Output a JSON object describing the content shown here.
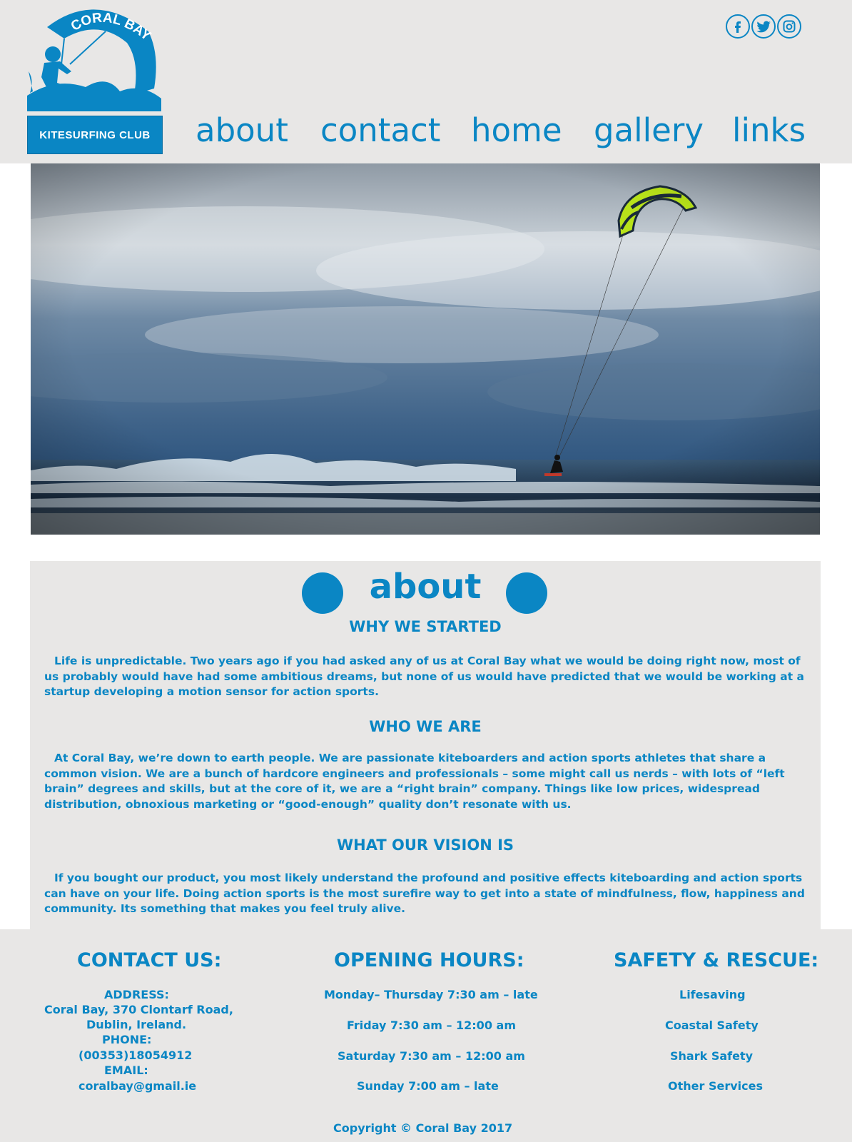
{
  "header": {
    "logo": {
      "arc_text": "CORAL BAY",
      "box_text": "KITESURFING CLUB"
    },
    "social": [
      {
        "name": "facebook-icon",
        "glyph": "f"
      },
      {
        "name": "twitter-icon",
        "glyph": "t"
      },
      {
        "name": "instagram-icon",
        "glyph": "ig"
      }
    ],
    "nav": [
      "about",
      "contact",
      "home",
      "gallery",
      "links"
    ]
  },
  "about": {
    "title": "about",
    "sections": [
      {
        "heading": "WHY WE STARTED",
        "body": "Life is unpredictable. Two years ago if you had asked any of us at Coral Bay what we would be doing right now, most of us probably would have had some ambitious dreams, but none of us would have predicted that we would be working at a startup developing a motion sensor for action sports."
      },
      {
        "heading": "WHO WE ARE",
        "body": "At Coral Bay, we’re down to earth people. We are passionate kiteboarders and action sports athletes that share a common vision. We are a bunch of hardcore engineers and professionals – some might call us nerds – with lots of “left brain” degrees and skills, but at the core of it, we are a “right brain” company. Things like low prices, widespread distribution, obnoxious marketing or “good-enough” quality don’t resonate with us."
      },
      {
        "heading": "WHAT OUR VISION IS",
        "body": "If you bought our product, you most likely understand the profound and positive effects kiteboarding and action sports can have on your life. Doing action sports is the most surefire way to get into a state of mindfulness, flow, happiness and community. Its something that makes you feel truly alive."
      }
    ]
  },
  "footer": {
    "contact": {
      "heading": "CONTACT US:",
      "address_label": "ADDRESS:",
      "address_line1": "Coral Bay, 370 Clontarf Road,",
      "address_line2": "Dublin, Ireland.",
      "phone_label": "PHONE:",
      "phone": "(00353)18054912",
      "email_label": "EMAIL:",
      "email": "coralbay@gmail.ie"
    },
    "hours": {
      "heading": "OPENING HOURS:",
      "lines": [
        "Monday– Thursday 7:30 am – late",
        "Friday 7:30 am – 12:00 am",
        "Saturday 7:30 am – 12:00 am",
        "Sunday 7:00 am – late"
      ]
    },
    "safety": {
      "heading": "SAFETY & RESCUE:",
      "links": [
        "Lifesaving",
        "Coastal Safety",
        "Shark Safety",
        "Other Services"
      ]
    },
    "copyright": "Copyright © Coral Bay  2017"
  },
  "colors": {
    "brand_blue": "#0a86c4",
    "panel_grey": "#e8e7e6",
    "kite_green": "#b8e21a"
  }
}
